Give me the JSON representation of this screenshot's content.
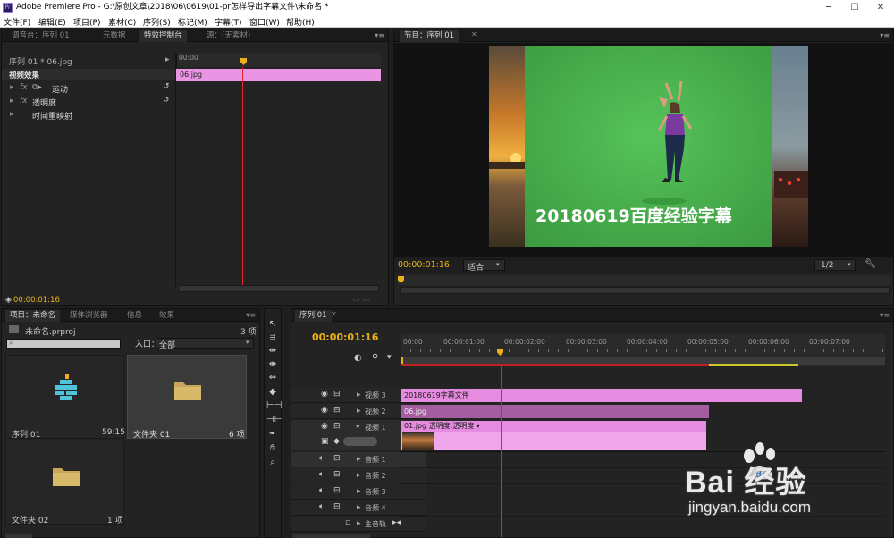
{
  "window": {
    "app_icon": "Pr",
    "title": "Adobe Premiere Pro - G:\\原创文章\\2018\\06\\0619\\01-pr怎样导出字幕文件\\未命名 *",
    "controls": [
      "─",
      "☐",
      "✕"
    ]
  },
  "menu": [
    "文件(F)",
    "编辑(E)",
    "项目(P)",
    "素材(C)",
    "序列(S)",
    "标记(M)",
    "字幕(T)",
    "窗口(W)",
    "帮助(H)"
  ],
  "effect_controls": {
    "tabs": [
      "调音台：序列 01",
      "元数据",
      "特效控制台",
      "源：(无素材)"
    ],
    "active_tab": "特效控制台",
    "source_label": "序列 01 * 06.jpg",
    "ruler_start": "00:00",
    "clip_name": "06.jpg",
    "section": "视频效果",
    "effects": [
      {
        "fx": "fx",
        "name": "运动"
      },
      {
        "fx": "fx",
        "name": "透明度"
      },
      {
        "fx": "",
        "name": "时间重映射"
      }
    ],
    "timecode": "00:00:01:16"
  },
  "program": {
    "tab": "节目：序列 01",
    "overlay_text": "20180619百度经验字幕",
    "timecode": "00:00:01:16",
    "fit": "适合",
    "resolution": "1/2",
    "transport": [
      "▼",
      "{",
      "}",
      "{←",
      "◀|",
      "▶",
      "|▶",
      "→}",
      "⧉",
      "⧉",
      "◙"
    ]
  },
  "project": {
    "tabs": [
      "项目：未命名",
      "媒体浏览器",
      "信息",
      "效果"
    ],
    "file": "未命名.prproj",
    "count": "3 项",
    "in_label": "入口：",
    "in_value": "全部",
    "items": [
      {
        "name": "序列 01",
        "meta": "59:15",
        "icon": "sequence-icon"
      },
      {
        "name": "文件夹 01",
        "meta": "6 项",
        "icon": "folder-icon"
      },
      {
        "name": "文件夹 02",
        "meta": "1 项",
        "icon": "folder-icon"
      }
    ]
  },
  "timeline": {
    "tab": "序列 01",
    "timecode": "00:00:01:16",
    "ticks": [
      "00:00",
      "00:00:01:00",
      "00:00:02:00",
      "00:00:03:00",
      "00:00:04:00",
      "00:00:05:00",
      "00:00:06:00",
      "00:00:07:00"
    ],
    "video_tracks": [
      "视频 3",
      "视频 2",
      "视频 1"
    ],
    "audio_tracks": [
      "音频 1",
      "音频 2",
      "音频 3",
      "音频 4"
    ],
    "master": "主音轨",
    "clips": {
      "v3": "20180619字幕文件",
      "v2": "06.jpg",
      "v1": "01.jpg 透明度:透明度 ▾"
    }
  },
  "watermark": {
    "brand": "Bai 经验",
    "url": "jingyan.baidu.com"
  },
  "colors": {
    "accent": "#e8b11a",
    "clip_pink": "#e68ce0",
    "playhead": "#e2252b",
    "greenscreen": "#46b54a"
  }
}
